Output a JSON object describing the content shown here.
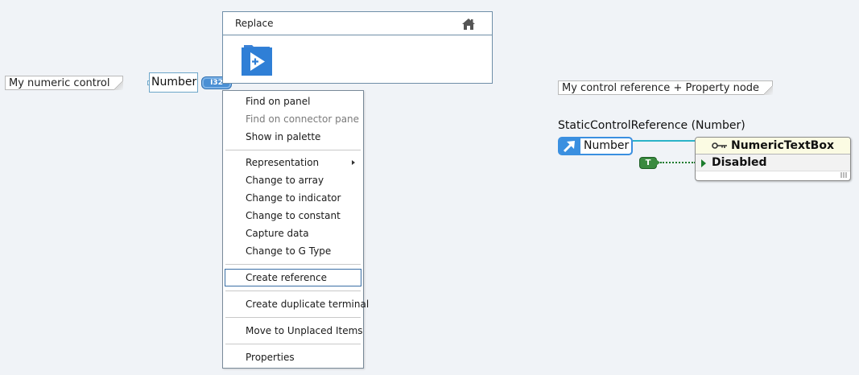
{
  "free_labels": {
    "numeric_control": "My numeric control",
    "control_reference": "My control reference + Property node"
  },
  "terminal": {
    "label": "Number",
    "type_badge": "I32"
  },
  "replace_panel": {
    "title": "Replace",
    "icons": [
      "home-icon",
      "vi-icon"
    ]
  },
  "context_menu": {
    "items": [
      {
        "label": "Find on panel",
        "enabled": true
      },
      {
        "label": "Find on connector pane",
        "enabled": false
      },
      {
        "label": "Show in palette",
        "enabled": true
      },
      {
        "label": "Representation",
        "enabled": true,
        "submenu": true
      },
      {
        "label": "Change to array",
        "enabled": true
      },
      {
        "label": "Change to indicator",
        "enabled": true
      },
      {
        "label": "Change to constant",
        "enabled": true
      },
      {
        "label": "Capture data",
        "enabled": true
      },
      {
        "label": "Change to G Type",
        "enabled": true
      },
      {
        "label": "Create reference",
        "enabled": true,
        "highlighted": true
      },
      {
        "label": "Create duplicate terminal",
        "enabled": true
      },
      {
        "label": "Move to Unplaced Items",
        "enabled": true
      },
      {
        "label": "Properties",
        "enabled": true
      }
    ]
  },
  "static_reference": {
    "title": "StaticControlReference (Number)",
    "label": "Number"
  },
  "boolean_constant": {
    "label": "T",
    "color": "#3a8a3f"
  },
  "property_node": {
    "class_name": "NumericTextBox",
    "property": "Disabled"
  },
  "colors": {
    "canvas": "#f0f3f7",
    "reference_wire": "#2bb3c8",
    "boolean_wire": "#1c7a2e",
    "reference_blue": "#3a8fe0",
    "header_yellow": "#fbfbe3"
  }
}
